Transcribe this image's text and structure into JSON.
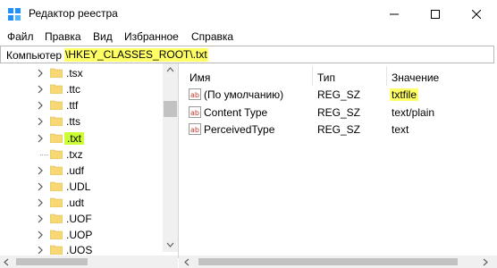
{
  "window": {
    "title": "Редактор реестра",
    "icon": "regedit-icon",
    "controls": [
      "minimize-icon",
      "maximize-icon",
      "close-icon"
    ]
  },
  "menu": {
    "items": [
      "Файл",
      "Правка",
      "Вид",
      "Избранное",
      "Справка"
    ]
  },
  "address": {
    "root": "Компьютер",
    "path": "\\HKEY_CLASSES_ROOT\\.txt"
  },
  "tree": {
    "items": [
      {
        "label": ".tsx",
        "expandable": true
      },
      {
        "label": ".ttc",
        "expandable": true
      },
      {
        "label": ".ttf",
        "expandable": true
      },
      {
        "label": ".tts",
        "expandable": true
      },
      {
        "label": ".txt",
        "expandable": true,
        "selected": true
      },
      {
        "label": ".txz",
        "expandable": false
      },
      {
        "label": ".udf",
        "expandable": true
      },
      {
        "label": ".UDL",
        "expandable": true
      },
      {
        "label": ".udt",
        "expandable": true
      },
      {
        "label": ".UOF",
        "expandable": true
      },
      {
        "label": ".UOP",
        "expandable": true
      },
      {
        "label": ".UOS",
        "expandable": true
      }
    ]
  },
  "values": {
    "columns": {
      "name": "Имя",
      "type": "Тип",
      "data": "Значение"
    },
    "rows": [
      {
        "name": "(По умолчанию)",
        "type": "REG_SZ",
        "data": "txtfile",
        "highlight": true
      },
      {
        "name": "Content Type",
        "type": "REG_SZ",
        "data": "text/plain",
        "highlight": false
      },
      {
        "name": "PerceivedType",
        "type": "REG_SZ",
        "data": "text",
        "highlight": false
      }
    ]
  },
  "colors": {
    "highlight_yellow": "#ffff66",
    "selection_green": "#ccff33",
    "folder_yellow": "#f8d775",
    "regsz_red": "#c0392b"
  }
}
